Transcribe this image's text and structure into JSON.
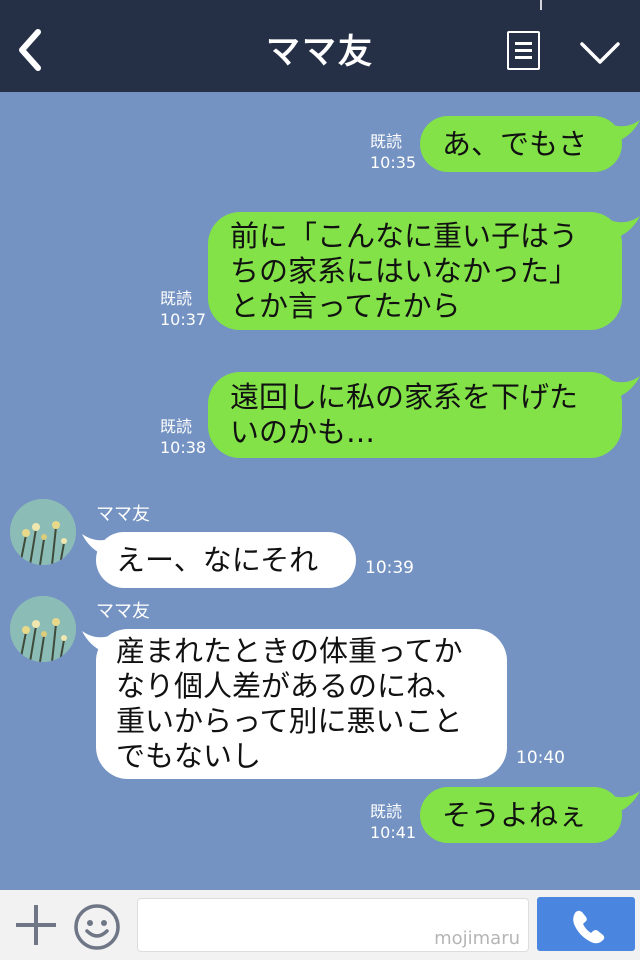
{
  "header": {
    "title": "ママ友"
  },
  "messages": [
    {
      "from": "me",
      "text": "あ、でもさ",
      "read": "既読",
      "time": "10:35"
    },
    {
      "from": "me",
      "text": "前に「こんなに重い子はう\nちの家系にはいなかった」\nとか言ってたから",
      "read": "既読",
      "time": "10:37"
    },
    {
      "from": "me",
      "text": "遠回しに私の家系を下げた\nいのかも…",
      "read": "既読",
      "time": "10:38"
    },
    {
      "from": "other",
      "sender": "ママ友",
      "text": "えー、なにそれ",
      "time": "10:39"
    },
    {
      "from": "other",
      "sender": "ママ友",
      "text": "産まれたときの体重ってか\nなり個人差があるのにね、\n重いからって別に悪いこと\nでもないし",
      "time": "10:40"
    },
    {
      "from": "me",
      "text": "そうよねぇ",
      "read": "既読",
      "time": "10:41"
    }
  ],
  "input": {
    "watermark": "mojimaru"
  },
  "colors": {
    "background": "#7493c2",
    "header": "#253047",
    "my_bubble": "#83e248",
    "other_bubble": "#ffffff",
    "call_button": "#4a86df"
  },
  "icons": [
    "back-arrow-icon",
    "menu-icon",
    "chevron-down-icon",
    "plus-icon",
    "emoji-icon",
    "phone-icon"
  ]
}
